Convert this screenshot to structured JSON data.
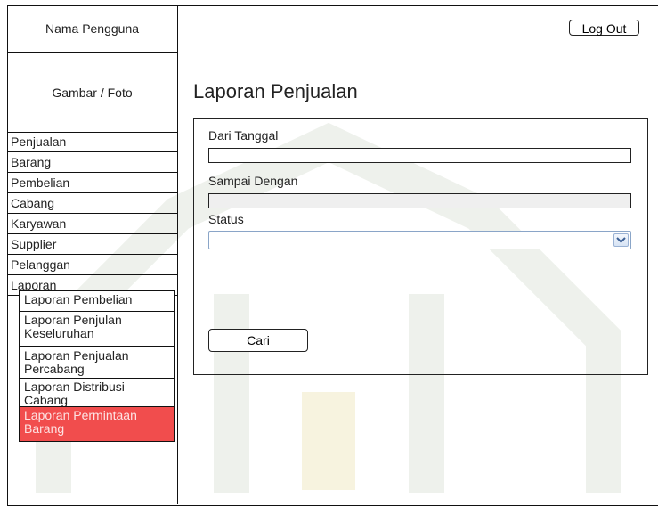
{
  "sidebar": {
    "user_name": "Nama Pengguna",
    "photo_label": "Gambar / Foto",
    "menu": [
      "Penjualan",
      "Barang",
      "Pembelian",
      "Cabang",
      "Karyawan",
      "Supplier",
      "Pelanggan",
      "Laporan"
    ],
    "submenu": [
      "Laporan Pembelian",
      "Laporan Penjulan Keseluruhan",
      "Laporan Penjualan Percabang",
      "Laporan Distribusi Cabang",
      "Laporan Permintaan Barang"
    ],
    "active_color": "#f14d4d"
  },
  "header": {
    "logout_label": "Log Out"
  },
  "main": {
    "title": "Laporan Penjualan",
    "form": {
      "from_label": "Dari Tanggal",
      "from_value": "",
      "to_label": "Sampai Dengan",
      "to_value": "",
      "status_label": "Status",
      "status_value": "",
      "search_label": "Cari"
    }
  }
}
